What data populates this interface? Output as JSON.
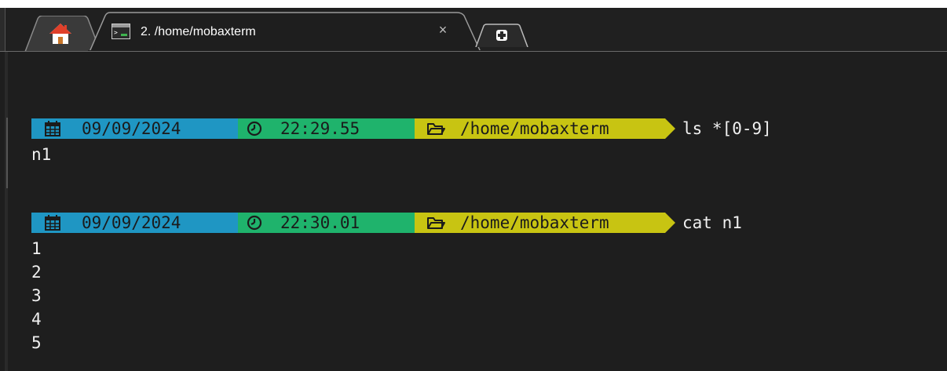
{
  "tabs": {
    "home_icon": "home-icon",
    "active": {
      "icon": "terminal-icon",
      "title": "2. /home/mobaxterm",
      "close_label": "×"
    },
    "new_tab_icon": "plus-icon"
  },
  "colors": {
    "background": "#1e1e1e",
    "date_segment": "#1f96c3",
    "time_segment": "#1fb36c",
    "dir_segment": "#c8c412",
    "text": "#e6e6e6"
  },
  "terminal": {
    "blocks": [
      {
        "prompt": {
          "date": "09/09/2024",
          "time": "22:29.55",
          "dir": "/home/mobaxterm",
          "command": "ls *[0-9]"
        },
        "output": [
          "n1"
        ]
      },
      {
        "prompt": {
          "date": "09/09/2024",
          "time": "22:30.01",
          "dir": "/home/mobaxterm",
          "command": "cat n1"
        },
        "output": [
          "1",
          "2",
          "3",
          "4",
          "5"
        ]
      }
    ]
  }
}
